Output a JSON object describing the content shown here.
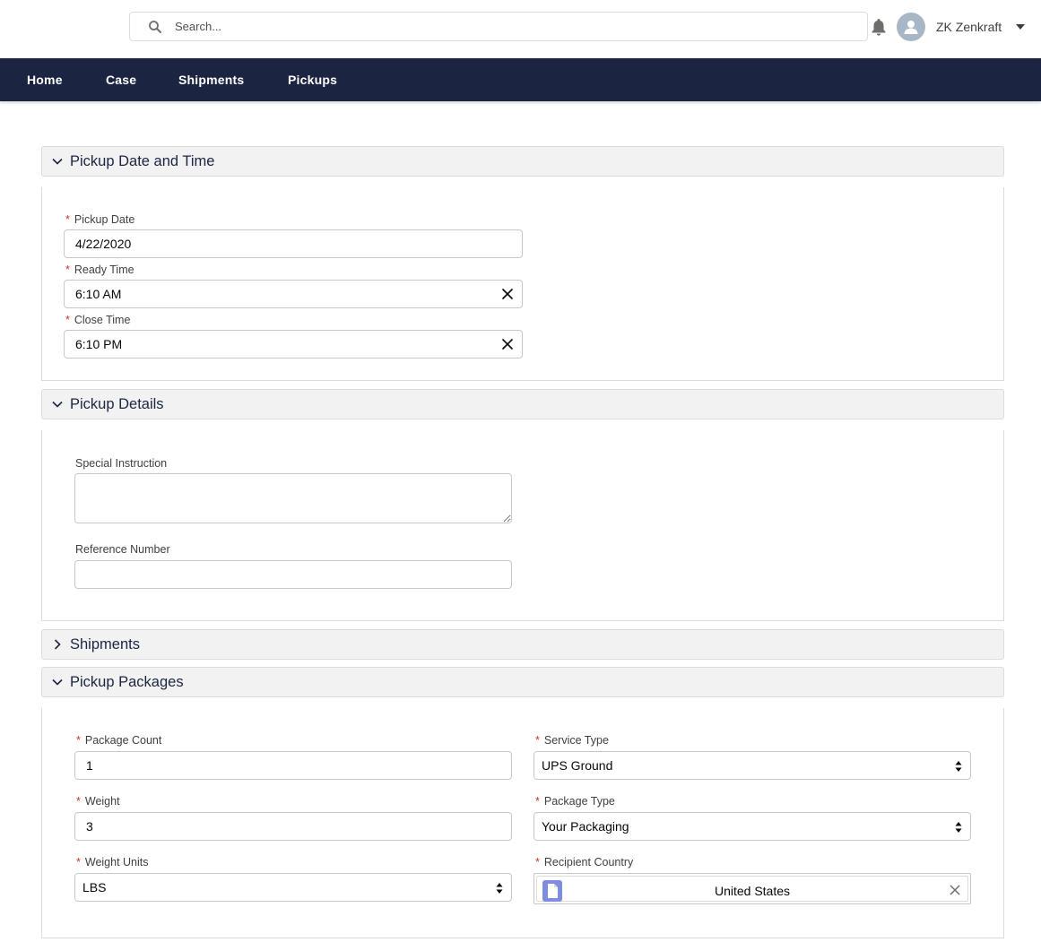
{
  "header": {
    "search_placeholder": "Search...",
    "user_name": "ZK Zenkraft"
  },
  "nav": {
    "items": [
      {
        "label": "Home"
      },
      {
        "label": "Case"
      },
      {
        "label": "Shipments"
      },
      {
        "label": "Pickups"
      }
    ]
  },
  "sections": {
    "pickup_date_time": {
      "title": "Pickup Date and Time",
      "pickup_date_label": "Pickup Date",
      "pickup_date_value": "4/22/2020",
      "ready_time_label": "Ready Time",
      "ready_time_value": "6:10 AM",
      "close_time_label": "Close Time",
      "close_time_value": "6:10 PM"
    },
    "pickup_details": {
      "title": "Pickup Details",
      "special_instruction_label": "Special Instruction",
      "special_instruction_value": "",
      "reference_number_label": "Reference Number",
      "reference_number_value": ""
    },
    "shipments": {
      "title": "Shipments",
      "expanded": false
    },
    "pickup_packages": {
      "title": "Pickup Packages",
      "package_count_label": "Package Count",
      "package_count_value": "1",
      "weight_label": "Weight",
      "weight_value": "3",
      "weight_units_label": "Weight Units",
      "weight_units_value": "LBS",
      "service_type_label": "Service Type",
      "service_type_value": "UPS Ground",
      "package_type_label": "Package Type",
      "package_type_value": "Your Packaging",
      "recipient_country_label": "Recipient Country",
      "recipient_country_value": "United States"
    }
  },
  "colors": {
    "nav_background": "#1b2542",
    "required_marker": "#c23934",
    "section_header_bg": "#f3f2f2",
    "lookup_icon": "#7f8de1"
  }
}
